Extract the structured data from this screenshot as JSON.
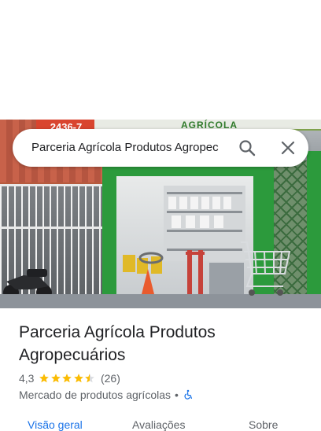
{
  "search": {
    "query": "Parceria Agrícola Produtos Agropec"
  },
  "photo": {
    "phone_fragment": "2436-7",
    "sign_text": "AGRÍCOLA"
  },
  "place": {
    "name": "Parceria Agrícola Produtos Agropecuários",
    "rating": "4,3",
    "rating_stars": 4.3,
    "review_count": "(26)",
    "category": "Mercado de produtos agrícolas",
    "separator": "•",
    "accessibility_icon": "wheelchair-icon"
  },
  "tabs": [
    {
      "label": "Visão geral",
      "active": true
    },
    {
      "label": "Avaliações",
      "active": false
    },
    {
      "label": "Sobre",
      "active": false
    }
  ],
  "colors": {
    "accent": "#1a73e8",
    "star": "#fbbc04",
    "store_green": "#2c9a3c"
  }
}
